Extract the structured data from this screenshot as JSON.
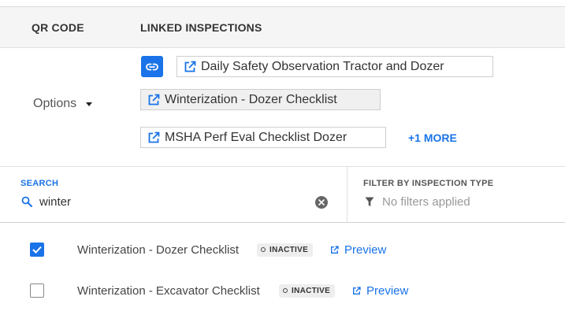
{
  "header": {
    "qr_code": "QR CODE",
    "linked_inspections": "LINKED INSPECTIONS"
  },
  "options": {
    "label": "Options"
  },
  "linked_chips": [
    {
      "label": "Daily Safety Observation Tractor and Dozer",
      "highlighted": false
    },
    {
      "label": "Winterization - Dozer Checklist",
      "highlighted": true
    },
    {
      "label": "MSHA Perf Eval Checklist Dozer",
      "highlighted": false
    }
  ],
  "more_link": "+1 MORE",
  "search": {
    "label": "SEARCH",
    "value": "winter"
  },
  "filter": {
    "label": "FILTER BY INSPECTION TYPE",
    "placeholder": "No filters applied"
  },
  "results": [
    {
      "name": "Winterization - Dozer Checklist",
      "status": "INACTIVE",
      "preview": "Preview",
      "checked": true
    },
    {
      "name": "Winterization - Excavator Checklist",
      "status": "INACTIVE",
      "preview": "Preview",
      "checked": false
    }
  ],
  "colors": {
    "accent": "#1a73e8",
    "header_bg": "#f5f5f5",
    "badge_bg": "#eeeeee"
  },
  "icons": {
    "link_button": "link-icon",
    "chip": "external-link-icon",
    "search": "search-icon",
    "clear": "clear-icon",
    "filter": "filter-icon",
    "checkbox_checked": "checkmark-icon",
    "preview": "external-link-icon"
  }
}
